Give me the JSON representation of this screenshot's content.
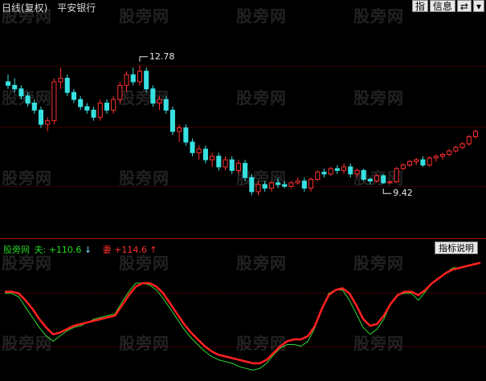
{
  "header": {
    "period": "日线(复权)",
    "stock": "平安银行"
  },
  "toolbar": {
    "btn_zhi": "指",
    "btn_info": "信息",
    "btn_arrow": "⇄",
    "btn_menu": "▾"
  },
  "price_panel": {
    "high_label": "12.78",
    "low_label": "9.42"
  },
  "indicator": {
    "name": "股旁网",
    "fast_label": "夫",
    "fast_value": "+110.6",
    "fast_arrow": "↓",
    "slow_label": "妻",
    "slow_value": "+114.6",
    "slow_arrow": "↑",
    "help_button": "指标说明"
  },
  "watermark_text": "股旁网",
  "colors": {
    "up": "#ff3030",
    "down": "#38e0e0",
    "fast_line": "#33dd33",
    "slow_line": "#ff2020"
  },
  "chart_data": [
    {
      "type": "candlestick",
      "title": "平安银行 日线(复权)",
      "ylim": [
        8.0,
        14.2
      ],
      "annotations": [
        {
          "text": "12.78",
          "index": 20,
          "value": 12.78
        },
        {
          "text": "9.42",
          "index": 57,
          "value": 9.42
        }
      ],
      "candles": [
        [
          12.3,
          12.5,
          12.1,
          12.2
        ],
        [
          12.2,
          12.4,
          12.0,
          12.1
        ],
        [
          12.1,
          12.2,
          11.8,
          11.9
        ],
        [
          11.9,
          12.0,
          11.6,
          11.7
        ],
        [
          11.7,
          11.8,
          11.4,
          11.5
        ],
        [
          11.5,
          11.6,
          11.0,
          11.1
        ],
        [
          11.1,
          11.3,
          10.9,
          11.2
        ],
        [
          11.2,
          12.4,
          11.1,
          12.3
        ],
        [
          12.3,
          12.7,
          12.1,
          12.4
        ],
        [
          12.4,
          12.5,
          11.9,
          12.0
        ],
        [
          12.0,
          12.1,
          11.7,
          11.8
        ],
        [
          11.8,
          11.9,
          11.5,
          11.6
        ],
        [
          11.6,
          11.7,
          11.4,
          11.5
        ],
        [
          11.5,
          11.6,
          11.2,
          11.3
        ],
        [
          11.3,
          11.8,
          11.2,
          11.7
        ],
        [
          11.7,
          11.8,
          11.4,
          11.5
        ],
        [
          11.5,
          11.9,
          11.4,
          11.8
        ],
        [
          11.8,
          12.3,
          11.7,
          12.2
        ],
        [
          12.2,
          12.6,
          12.0,
          12.5
        ],
        [
          12.5,
          12.7,
          12.2,
          12.3
        ],
        [
          12.3,
          12.78,
          12.2,
          12.6
        ],
        [
          12.6,
          12.7,
          12.0,
          12.1
        ],
        [
          12.1,
          12.2,
          11.6,
          11.7
        ],
        [
          11.7,
          11.9,
          11.5,
          11.8
        ],
        [
          11.8,
          11.9,
          11.4,
          11.5
        ],
        [
          11.5,
          11.6,
          10.8,
          10.9
        ],
        [
          10.9,
          11.1,
          10.6,
          11.0
        ],
        [
          11.0,
          11.1,
          10.5,
          10.6
        ],
        [
          10.6,
          10.7,
          10.2,
          10.3
        ],
        [
          10.3,
          10.5,
          10.1,
          10.4
        ],
        [
          10.4,
          10.5,
          10.0,
          10.1
        ],
        [
          10.1,
          10.3,
          9.9,
          10.2
        ],
        [
          10.2,
          10.3,
          9.8,
          9.9
        ],
        [
          9.9,
          10.2,
          9.8,
          10.1
        ],
        [
          10.1,
          10.2,
          9.7,
          9.8
        ],
        [
          9.8,
          10.1,
          9.7,
          10.0
        ],
        [
          10.0,
          10.1,
          9.5,
          9.6
        ],
        [
          9.6,
          9.7,
          9.1,
          9.2
        ],
        [
          9.2,
          9.5,
          9.1,
          9.4
        ],
        [
          9.4,
          9.5,
          9.2,
          9.3
        ],
        [
          9.3,
          9.5,
          9.2,
          9.45
        ],
        [
          9.45,
          9.6,
          9.3,
          9.4
        ],
        [
          9.4,
          9.5,
          9.3,
          9.35
        ],
        [
          9.35,
          9.5,
          9.3,
          9.45
        ],
        [
          9.45,
          9.6,
          9.4,
          9.5
        ],
        [
          9.5,
          9.6,
          9.2,
          9.3
        ],
        [
          9.3,
          9.6,
          9.2,
          9.55
        ],
        [
          9.55,
          9.8,
          9.5,
          9.75
        ],
        [
          9.75,
          9.85,
          9.6,
          9.7
        ],
        [
          9.7,
          9.9,
          9.65,
          9.85
        ],
        [
          9.85,
          9.95,
          9.7,
          9.8
        ],
        [
          9.8,
          10.0,
          9.7,
          9.9
        ],
        [
          9.9,
          10.0,
          9.6,
          9.7
        ],
        [
          9.7,
          9.85,
          9.6,
          9.8
        ],
        [
          9.8,
          9.85,
          9.5,
          9.55
        ],
        [
          9.55,
          9.6,
          9.4,
          9.5
        ],
        [
          9.5,
          9.7,
          9.45,
          9.65
        ],
        [
          9.65,
          9.7,
          9.42,
          9.45
        ],
        [
          9.45,
          9.5,
          9.42,
          9.48
        ],
        [
          9.48,
          9.9,
          9.45,
          9.85
        ],
        [
          9.85,
          10.0,
          9.8,
          9.95
        ],
        [
          9.95,
          10.1,
          9.9,
          10.05
        ],
        [
          10.05,
          10.15,
          9.95,
          10.1
        ],
        [
          10.1,
          10.2,
          9.9,
          9.95
        ],
        [
          9.95,
          10.2,
          9.9,
          10.15
        ],
        [
          10.15,
          10.25,
          10.05,
          10.2
        ],
        [
          10.2,
          10.3,
          10.1,
          10.25
        ],
        [
          10.25,
          10.4,
          10.2,
          10.35
        ],
        [
          10.35,
          10.5,
          10.3,
          10.45
        ],
        [
          10.45,
          10.6,
          10.4,
          10.55
        ],
        [
          10.55,
          10.8,
          10.5,
          10.75
        ],
        [
          10.75,
          10.95,
          10.7,
          10.9
        ]
      ]
    },
    {
      "type": "line",
      "series": [
        {
          "name": "夫",
          "values": [
            100,
            100,
            96,
            84,
            72,
            60,
            50,
            44,
            50,
            56,
            60,
            62,
            66,
            70,
            72,
            74,
            76,
            90,
            102,
            112,
            112,
            110,
            104,
            94,
            82,
            70,
            58,
            48,
            40,
            32,
            26,
            22,
            20,
            18,
            14,
            12,
            10,
            12,
            18,
            28,
            36,
            40,
            40,
            38,
            44,
            60,
            82,
            100,
            104,
            104,
            92,
            76,
            60,
            52,
            58,
            70,
            88,
            98,
            100,
            100,
            92,
            102,
            112,
            118,
            124,
            130,
            130,
            132,
            134,
            136
          ]
        },
        {
          "name": "妻",
          "values": [
            102,
            102,
            100,
            92,
            82,
            70,
            60,
            52,
            54,
            58,
            62,
            64,
            66,
            68,
            70,
            72,
            74,
            86,
            98,
            108,
            112,
            112,
            108,
            100,
            88,
            76,
            64,
            54,
            46,
            38,
            32,
            28,
            26,
            24,
            22,
            20,
            18,
            18,
            22,
            30,
            38,
            44,
            46,
            46,
            50,
            62,
            82,
            98,
            104,
            106,
            100,
            86,
            70,
            62,
            64,
            74,
            88,
            98,
            102,
            102,
            98,
            104,
            112,
            118,
            124,
            128,
            130,
            132,
            134,
            136
          ]
        }
      ],
      "ylim": [
        0,
        145
      ]
    }
  ]
}
